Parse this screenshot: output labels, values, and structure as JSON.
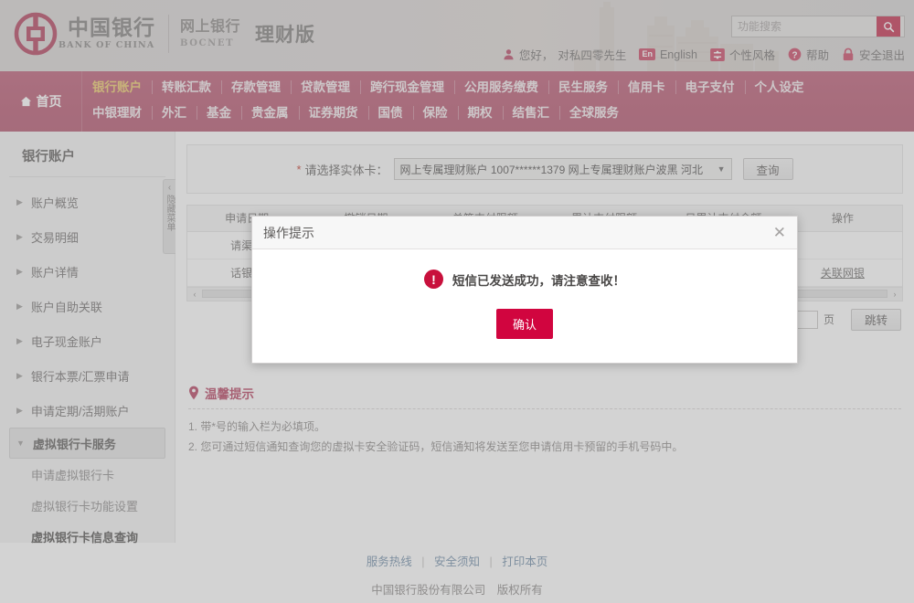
{
  "header": {
    "logo_cn": "中国银行",
    "logo_en": "BANK OF CHINA",
    "sub_cn": "网上银行",
    "sub_en": "BOCNET",
    "edition": "理财版",
    "search": {
      "placeholder": "功能搜索",
      "value": "",
      "icon": "search-icon"
    },
    "user": {
      "greeting": "您好，",
      "username": "对私四零先生",
      "lang_badge": "En",
      "lang_label": "English",
      "style_label": "个性风格",
      "help_label": "帮助",
      "logout_label": "安全退出"
    }
  },
  "nav": {
    "home_label": "首页",
    "row1": [
      "银行账户",
      "转账汇款",
      "存款管理",
      "贷款管理",
      "跨行现金管理",
      "公用服务缴费",
      "民生服务",
      "信用卡",
      "电子支付",
      "个人设定"
    ],
    "row2": [
      "中银理财",
      "外汇",
      "基金",
      "贵金属",
      "证券期货",
      "国债",
      "保险",
      "期权",
      "结售汇",
      "全球服务"
    ],
    "active": "银行账户",
    "bar_color": "#b5506b",
    "active_color": "#edc967"
  },
  "sidebar": {
    "title": "银行账户",
    "items": [
      {
        "label": "账户概览"
      },
      {
        "label": "交易明细"
      },
      {
        "label": "账户详情"
      },
      {
        "label": "账户自助关联"
      },
      {
        "label": "电子现金账户"
      },
      {
        "label": "银行本票/汇票申请"
      },
      {
        "label": "申请定期/活期账户"
      }
    ],
    "open_group": "虚拟银行卡服务",
    "sub_items": [
      {
        "label": "申请虚拟银行卡",
        "current": false
      },
      {
        "label": "虚拟银行卡功能设置",
        "current": false
      },
      {
        "label": "虚拟银行卡信息查询",
        "current": true
      }
    ],
    "collapse": {
      "chevron": "‹",
      "label": "隐藏菜单"
    }
  },
  "main": {
    "form": {
      "required_mark": "*",
      "label": "请选择实体卡：",
      "select_value": "网上专属理财账户  1007******1379 网上专属理财账户波黑 河北",
      "select_caret": "▼",
      "query_button": "查询"
    },
    "table": {
      "headers": [
        "申请日期",
        "撤销日期",
        "单笔支付限额",
        "累计支付限额",
        "日累计支付金额",
        "操作"
      ],
      "row_labels": [
        "请渠道",
        "话银行"
      ],
      "link": "关联网银",
      "scroll_left": "‹",
      "scroll_right": "›"
    },
    "pager": {
      "page_value": "",
      "page_unit": "页",
      "goto_button": "跳转"
    },
    "tips": {
      "icon": "location-pin-icon",
      "title": "温馨提示",
      "items": [
        "1. 带*号的输入栏为必填项。",
        "2. 您可通过短信通知查询您的虚拟卡安全验证码，短信通知将发送至您申请信用卡预留的手机号码中。"
      ]
    }
  },
  "modal": {
    "title": "操作提示",
    "close_icon": "close-icon",
    "warn_icon": "!",
    "message": "短信已发送成功，请注意查收！",
    "confirm_button": "确认",
    "accent_color": "#d1053f"
  },
  "footer": {
    "links": [
      "服务热线",
      "安全须知",
      "打印本页"
    ],
    "separator": "|",
    "copyright": "中国银行股份有限公司　版权所有"
  }
}
